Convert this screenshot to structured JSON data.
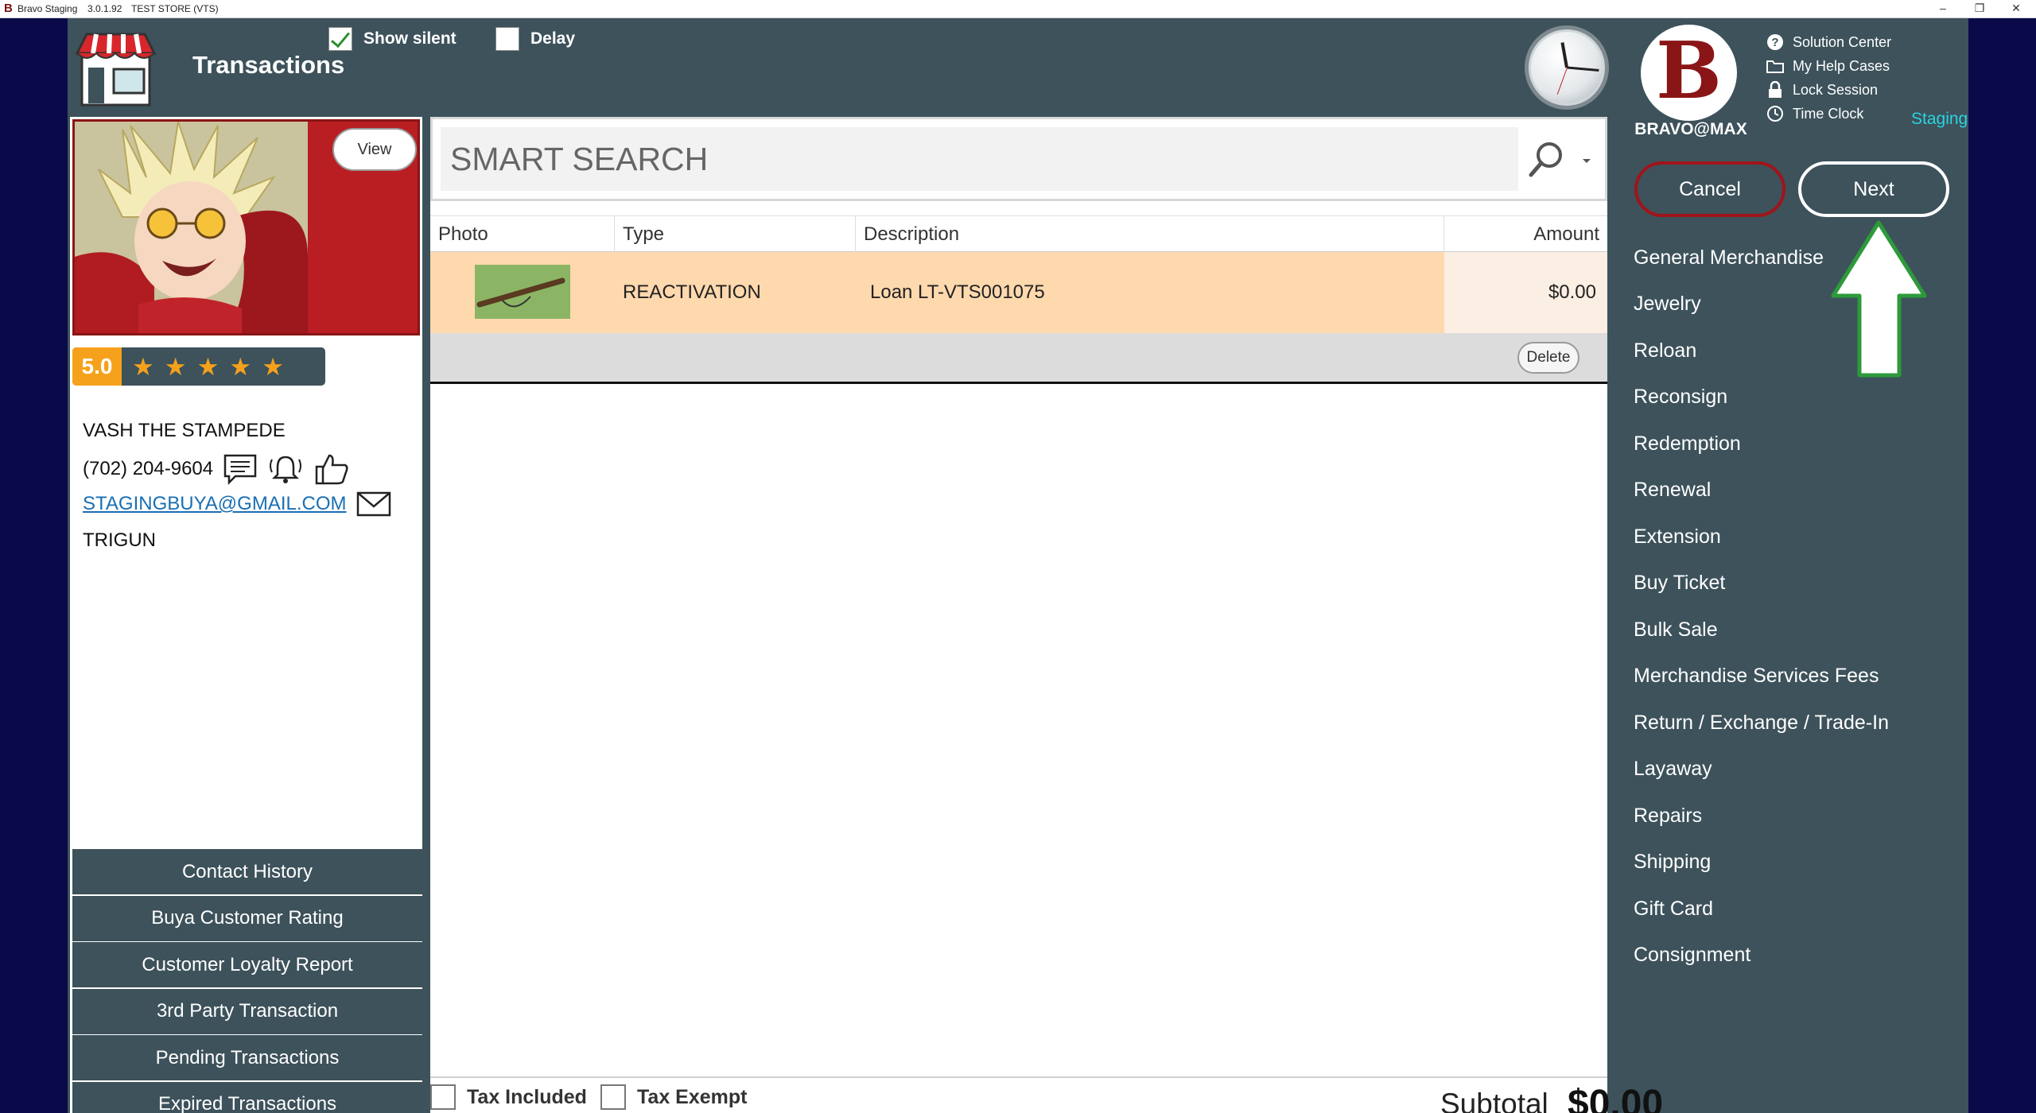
{
  "titlebar": {
    "logo_glyph": "B",
    "app_name": "Bravo Staging",
    "version": "3.0.1.92",
    "store": "TEST STORE (VTS)",
    "minimize": "–",
    "restore": "❐",
    "close": "✕"
  },
  "header": {
    "title": "Transactions",
    "show_silent_label": "Show silent",
    "show_silent_checked": true,
    "delay_label": "Delay",
    "delay_checked": false,
    "logo_glyph": "B",
    "brand_name": "BRAVO@MAX",
    "staging_label": "Staging",
    "help_links": [
      "Solution Center",
      "My Help Cases",
      "Lock Session",
      "Time Clock"
    ]
  },
  "customer": {
    "view_label": "View",
    "rating": "5.0",
    "stars": 5,
    "name": "VASH THE STAMPEDE",
    "phone": "(702) 204-9604",
    "email": "STAGINGBUYA@GMAIL.COM",
    "note": "TRIGUN"
  },
  "left_menu": [
    "Contact History",
    "Buya Customer Rating",
    "Customer Loyalty Report",
    "3rd Party Transaction",
    "Pending Transactions",
    "Expired Transactions"
  ],
  "search": {
    "placeholder": "SMART SEARCH"
  },
  "table": {
    "columns": [
      "Photo",
      "Type",
      "Description",
      "Amount"
    ],
    "rows": [
      {
        "type": "REACTIVATION",
        "description": "Loan LT-VTS001075",
        "amount": "$0.00"
      }
    ],
    "delete_label": "Delete"
  },
  "footer": {
    "tax_included_label": "Tax Included",
    "tax_exempt_label": "Tax Exempt",
    "subtotal_label": "Subtotal",
    "subtotal_value": "$0.00"
  },
  "actions": {
    "cancel_label": "Cancel",
    "next_label": "Next"
  },
  "transaction_types": [
    "General Merchandise",
    "Jewelry",
    "Reloan",
    "Reconsign",
    "Redemption",
    "Renewal",
    "Extension",
    "Buy Ticket",
    "Bulk Sale",
    "Merchandise Services Fees",
    "Return / Exchange / Trade-In",
    "Layaway",
    "Repairs",
    "Shipping",
    "Gift Card",
    "Consignment"
  ],
  "colors": {
    "panel": "#3d525b",
    "desktop": "#0a0a4a",
    "rating_orange": "#f6a11b",
    "cancel_border": "#a0141a",
    "selected_row": "#ffd9ae",
    "arrow_green": "#2d9a3a",
    "staging_cyan": "#2ad3e0"
  }
}
